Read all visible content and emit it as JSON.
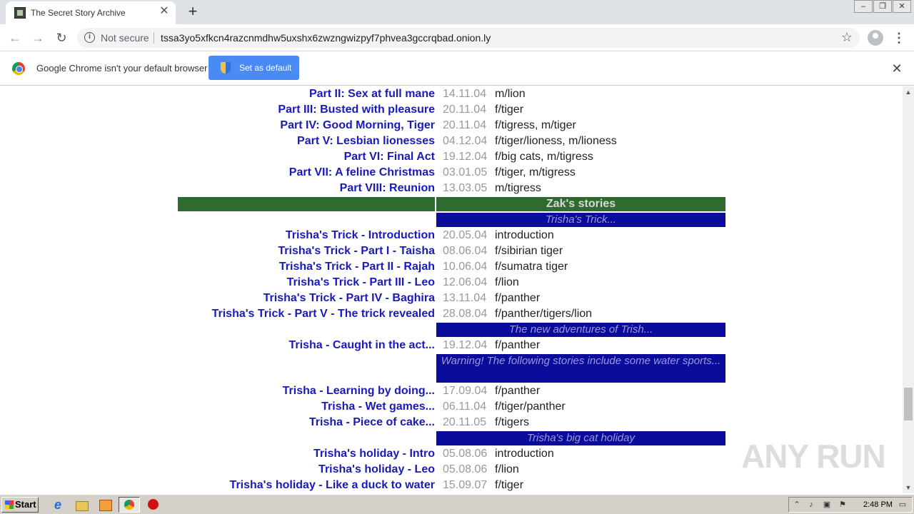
{
  "browser": {
    "tab_title": "The Secret Story Archive",
    "tab_close": "✕",
    "new_tab": "+",
    "security_label": "Not secure",
    "url": "tssa3yo5xfkcn4razcnmdhw5uxshx6zwzngwizpyf7phvea3gccrqbad.onion.ly"
  },
  "infobar": {
    "message": "Google Chrome isn't your default browser",
    "button_label": "Set as default",
    "close": "✕"
  },
  "rows_top": [
    {
      "title": "Part II: Sex at full mane",
      "date": "14.11.04",
      "category": "m/lion"
    },
    {
      "title": "Part III: Busted with pleasure",
      "date": "20.11.04",
      "category": "f/tiger"
    },
    {
      "title": "Part IV: Good Morning, Tiger",
      "date": "20.11.04",
      "category": "f/tigress, m/tiger"
    },
    {
      "title": "Part V: Lesbian lionesses",
      "date": "04.12.04",
      "category": "f/tiger/lioness, m/lioness"
    },
    {
      "title": "Part VI: Final Act",
      "date": "19.12.04",
      "category": "f/big cats, m/tigress"
    },
    {
      "title": "Part VII: A feline Christmas",
      "date": "03.01.05",
      "category": "f/tiger, m/tigress"
    },
    {
      "title": "Part VIII: Reunion",
      "date": "13.03.05",
      "category": "m/tigress"
    }
  ],
  "section": {
    "title": "Zak's stories"
  },
  "sub1": {
    "title": "Trisha's Trick..."
  },
  "rows_trick": [
    {
      "title": "Trisha's Trick - Introduction",
      "date": "20.05.04",
      "category": "introduction"
    },
    {
      "title": "Trisha's Trick - Part I - Taisha",
      "date": "08.06.04",
      "category": "f/sibirian tiger"
    },
    {
      "title": "Trisha's Trick - Part II - Rajah",
      "date": "10.06.04",
      "category": "f/sumatra tiger"
    },
    {
      "title": "Trisha's Trick - Part III - Leo",
      "date": "12.06.04",
      "category": "f/lion"
    },
    {
      "title": "Trisha's Trick - Part IV - Baghira",
      "date": "13.11.04",
      "category": "f/panther"
    },
    {
      "title": "Trisha's Trick - Part V - The trick revealed",
      "date": "28.08.04",
      "category": "f/panther/tigers/lion"
    }
  ],
  "sub2": {
    "title": "The new adventures of Trish..."
  },
  "rows_new": [
    {
      "title": "Trisha - Caught in the act...",
      "date": "19.12.04",
      "category": "f/panther"
    }
  ],
  "sub3": {
    "title": "Warning! The following stories include some water sports..."
  },
  "rows_water": [
    {
      "title": "Trisha - Learning by doing...",
      "date": "17.09.04",
      "category": "f/panther"
    },
    {
      "title": "Trisha - Wet games...",
      "date": "06.11.04",
      "category": "f/tiger/panther"
    },
    {
      "title": "Trisha - Piece of cake...",
      "date": "20.11.05",
      "category": "f/tigers"
    }
  ],
  "sub4": {
    "title": "Trisha's big cat holiday"
  },
  "rows_holiday": [
    {
      "title": "Trisha's holiday - Intro",
      "date": "05.08.06",
      "category": "introduction"
    },
    {
      "title": "Trisha's holiday - Leo",
      "date": "05.08.06",
      "category": "f/lion"
    },
    {
      "title": "Trisha's holiday - Like a duck to water",
      "date": "15.09.07",
      "category": "f/tiger"
    }
  ],
  "watermark": "ANY RUN",
  "taskbar": {
    "start_label": "Start",
    "clock": "2:48 PM"
  },
  "colors": {
    "link": "#1a1ab8",
    "section_green": "#2f6b2f",
    "subheader_blue": "#0c0c9c"
  }
}
